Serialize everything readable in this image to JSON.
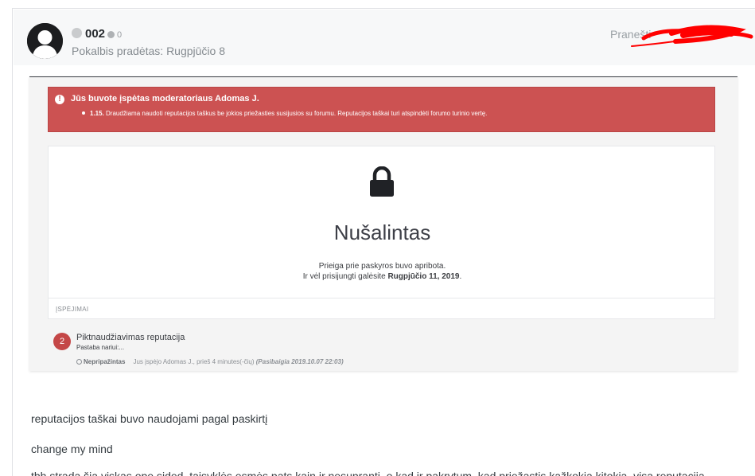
{
  "post": {
    "username": "002",
    "reputation": "0",
    "started": "Pokalbis pradėtas: Rugpjūčio 8",
    "report_label": "Pranešti"
  },
  "screenshot": {
    "warning_title": "Jūs buvote įspėtas moderatoriaus Adomas J.",
    "rule_number": "1.15.",
    "rule_text": "Draudžiama naudoti reputacijos taškus be jokios priežasties susijusios su forumu. Reputacijos taškai turi atspindėti forumo turinio vertę.",
    "suspended_title": "Nušalintas",
    "restriction_note": "Prieiga prie paskyros buvo apribota.",
    "relogin_prefix": "Ir vėl prisijungti galėsite ",
    "relogin_date": "Rugpjūčio 11, 2019",
    "relogin_suffix": ".",
    "warnings_header": "ĮSPĖJIMAI",
    "warning_item": {
      "points": "2",
      "title": "Piktnaudžiavimas reputacija",
      "subtitle": "Pastaba nariui:...",
      "status": "Nepripažintas",
      "meta": "Jus įspėjo Adomas J., prieš 4 minutes(-čių)",
      "expires": "(Pasibaigia 2019.10.07 22:03)"
    }
  },
  "body": {
    "line1": "reputacijos taškai buvo naudojami pagal paskirtį",
    "line2": "change my mind",
    "line3": "tbh strada šia viskas ope sided. taisyklės esmės pats kain ir nesuprantį, o kad ir pakrytum, kad priežastis kažkokia kitokia, visa reputacija"
  },
  "colors": {
    "warning_banner": "#cc5252",
    "badge": "#c44747",
    "scribble": "#ff0000"
  }
}
